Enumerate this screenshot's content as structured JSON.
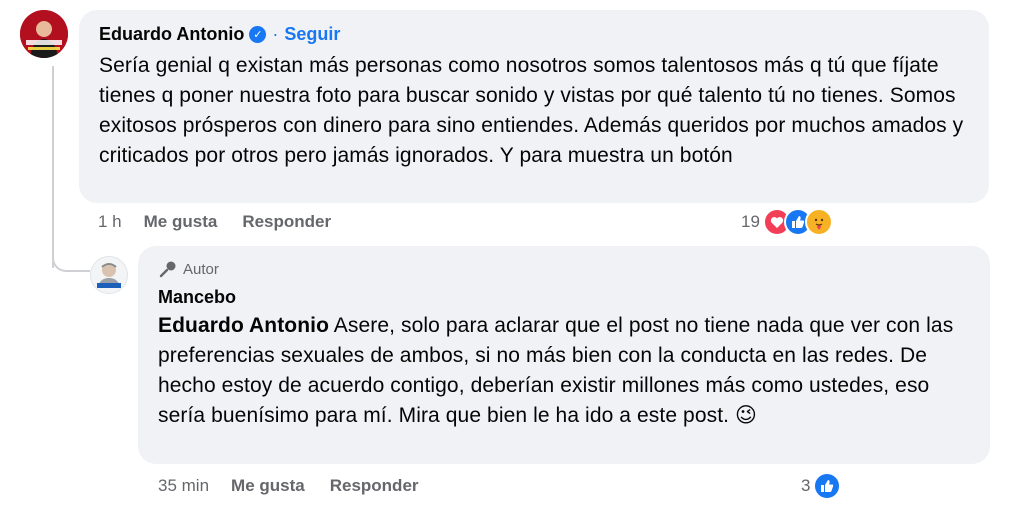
{
  "comments": [
    {
      "author": "Eduardo Antonio",
      "verified": true,
      "separator": "·",
      "follow_label": "Seguir",
      "text": "Sería genial q existan más personas como nosotros somos talentosos más q tú que fíjate tienes q poner nuestra foto para buscar sonido y vistas por qué talento tú no tienes. Somos exitosos prósperos con dinero para sino entiendes. Además queridos por muchos amados y criticados por otros pero jamás ignorados. Y para muestra un botón",
      "time": "1 h",
      "like_label": "Me gusta",
      "reply_label": "Responder",
      "reaction_count": "19",
      "reaction_icons": [
        "heart-icon",
        "like-icon",
        "care-icon"
      ]
    },
    {
      "role_badge": "Autor",
      "author": "Mancebo",
      "mention": "Eduardo Antonio",
      "text": " Asere, solo para aclarar que el post no tiene nada que ver con las preferencias sexuales de ambos, si no más bien con la conducta en las redes. De hecho estoy de acuerdo contigo, deberían existir millones más como ustedes, eso sería buenísimo para mí. Mira que bien le ha ido a este post. 😉",
      "time": "35 min",
      "like_label": "Me gusta",
      "reply_label": "Responder",
      "reaction_count": "3",
      "reaction_icons": [
        "like-icon"
      ]
    }
  ],
  "colors": {
    "bubble": "#f0f2f5",
    "link": "#1877f2",
    "meta": "#65676b",
    "heart": "#f33e58",
    "care": "#f7b125"
  }
}
